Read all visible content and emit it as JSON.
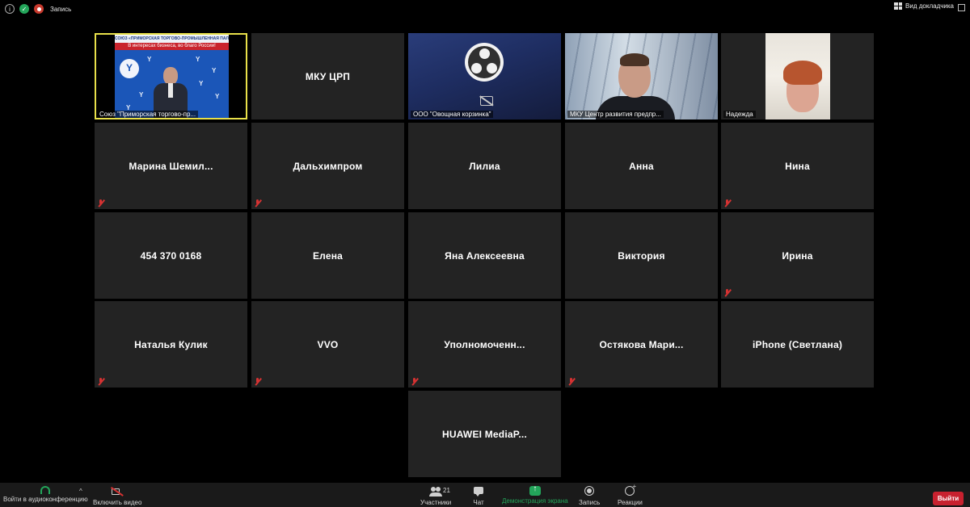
{
  "topbar": {
    "recording_label": "Запись",
    "view_label": "Вид докладчика",
    "icons": [
      "info-icon",
      "shield-icon",
      "record-icon",
      "grid-icon",
      "expand-icon"
    ]
  },
  "video_tiles": {
    "speaker": {
      "caption": "Союз \"Приморская торгово-пр...",
      "banner_top": "СОЮЗ «ПРИМОРСКАЯ ТОРГОВО-ПРОМЫШЛЕННАЯ ПАЛАТА»",
      "banner_red": "В интересах бизнеса, во благо России!"
    },
    "obs": {
      "caption": "ООО \"Овощная корзинка\""
    },
    "man": {
      "caption": "МКУ Центр развития предпр..."
    },
    "woman": {
      "caption": "Надежда"
    }
  },
  "tiles": [
    {
      "name": "МКУ ЦРП",
      "muted": false
    },
    {
      "name": "Марина  Шемил...",
      "muted": true
    },
    {
      "name": "Дальхимпром",
      "muted": true
    },
    {
      "name": "Лилиа",
      "muted": false
    },
    {
      "name": "Анна",
      "muted": false
    },
    {
      "name": "Нина",
      "muted": true
    },
    {
      "name": "454 370 0168",
      "muted": false
    },
    {
      "name": "Елена",
      "muted": false
    },
    {
      "name": "Яна Алексеевна",
      "muted": false
    },
    {
      "name": "Виктория",
      "muted": false
    },
    {
      "name": "Ирина",
      "muted": true
    },
    {
      "name": "Наталья Кулик",
      "muted": true
    },
    {
      "name": "VVO",
      "muted": true
    },
    {
      "name": "Уполномоченн...",
      "muted": true
    },
    {
      "name": "Остякова  Мари...",
      "muted": true
    },
    {
      "name": "iPhone (Светлана)",
      "muted": false
    },
    {
      "name": "HUAWEI  MediaP...",
      "muted": false
    }
  ],
  "toolbar": {
    "audio_label": "Войти в аудиоконференцию",
    "video_label": "Включить видео",
    "participants_label": "Участники",
    "participants_count": "21",
    "chat_label": "Чат",
    "share_label": "Демонстрация экрана",
    "record_label": "Запись",
    "reactions_label": "Реакции",
    "leave_label": "Выйти"
  },
  "colors": {
    "background": "#000000",
    "tile": "#232323",
    "active_speaker_border": "#e8e04a",
    "muted_mic": "#d63232",
    "share_green": "#23a55a",
    "leave_red": "#c8212f"
  }
}
